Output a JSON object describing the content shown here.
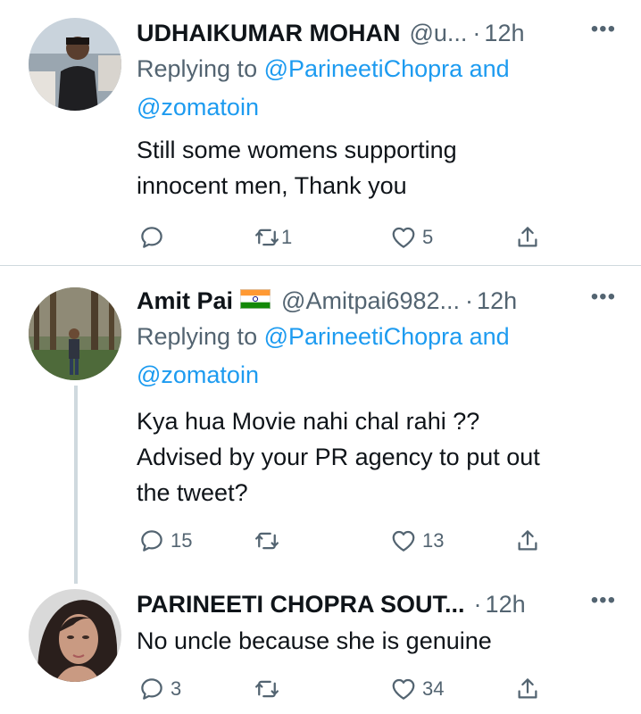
{
  "tweets": [
    {
      "name": "UDHAIKUMAR MOHAN",
      "handle": "@u...",
      "time": "12h",
      "replying_prefix": "Replying to ",
      "mention1": "@ParineetiChopra",
      "and": " and",
      "mention2": "@zomatoin",
      "text_lines": [
        "Still some womens supporting",
        "innocent men, Thank you"
      ],
      "replies": "",
      "retweets": "1",
      "likes": "5"
    },
    {
      "name": "Amit Pai",
      "handle": "@Amitpai6982...",
      "time": "12h",
      "replying_prefix": "Replying to ",
      "mention1": "@ParineetiChopra",
      "and": " and",
      "mention2": "@zomatoin",
      "text_lines": [
        "Kya hua Movie nahi chal rahi ??",
        "Advised by your PR agency to put out",
        "the tweet?"
      ],
      "replies": "15",
      "retweets": "",
      "likes": "13"
    },
    {
      "name": "PARINEETI CHOPRA SOUT...",
      "time": "12h",
      "text_lines": [
        "No uncle because she is genuine"
      ],
      "replies": "3",
      "retweets": "",
      "likes": "34"
    }
  ],
  "more_label": "•••",
  "dot": "·",
  "icons": {
    "reply": "reply-icon",
    "retweet": "retweet-icon",
    "like": "heart-icon",
    "share": "share-icon",
    "flag": "india-flag-icon"
  },
  "colors": {
    "text": "#0f1419",
    "secondary": "#536471",
    "link": "#1d9bf0",
    "divider": "#cfd9de"
  }
}
